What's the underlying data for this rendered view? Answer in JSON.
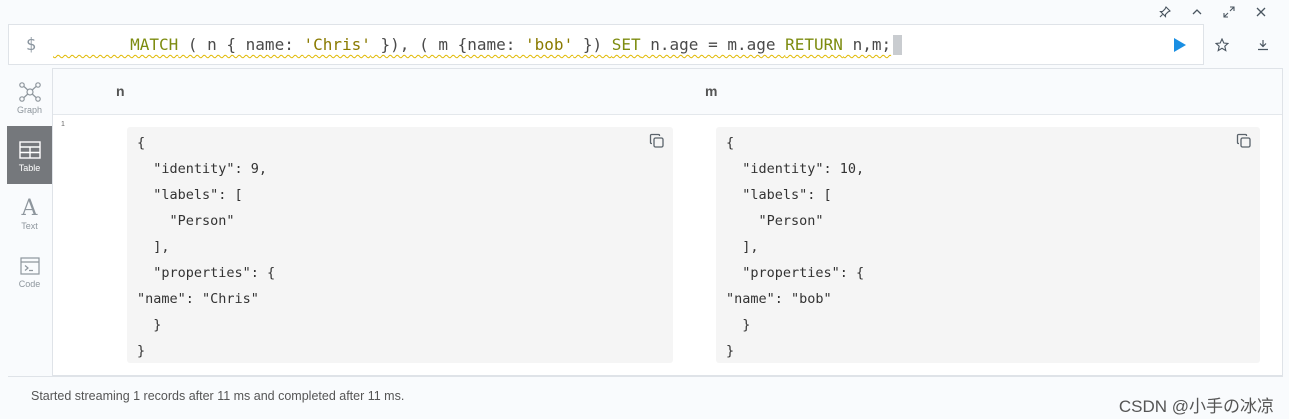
{
  "window": {
    "controls": [
      {
        "name": "pin-icon"
      },
      {
        "name": "collapse-icon"
      },
      {
        "name": "fullscreen-icon"
      },
      {
        "name": "close-icon"
      }
    ]
  },
  "editor": {
    "prompt": "$",
    "tokens": {
      "t1": "MATCH",
      "t2": " ( n { name: ",
      "t3": "'Chris'",
      "t4": " }), ( m {name: ",
      "t5": "'bob'",
      "t6": " }) ",
      "t7": "SET",
      "t8": " n.age = m.age ",
      "t9": "RETURN",
      "t10": " n,m;"
    }
  },
  "sidebar": {
    "items": [
      {
        "label": "Graph",
        "icon": "graph-icon",
        "active": false
      },
      {
        "label": "Table",
        "icon": "table-icon",
        "active": true
      },
      {
        "label": "Text",
        "icon": "text-icon",
        "active": false
      },
      {
        "label": "Code",
        "icon": "code-icon",
        "active": false
      }
    ]
  },
  "table": {
    "columns": [
      "n",
      "m"
    ],
    "row_number": "1",
    "cells": [
      "{\n  \"identity\": 9,\n  \"labels\": [\n    \"Person\"\n  ],\n  \"properties\": {\n\"name\": \"Chris\"\n  }\n}",
      "{\n  \"identity\": 10,\n  \"labels\": [\n    \"Person\"\n  ],\n  \"properties\": {\n\"name\": \"bob\"\n  }\n}"
    ]
  },
  "footer": {
    "status": "Started streaming 1 records after 11 ms and completed after 11 ms."
  },
  "watermark": "CSDN @小手の冰凉",
  "colors": {
    "keyword": "#7d8c10",
    "string": "#8a7a00",
    "run": "#1a8fe3",
    "active_tab": "#75787c"
  }
}
